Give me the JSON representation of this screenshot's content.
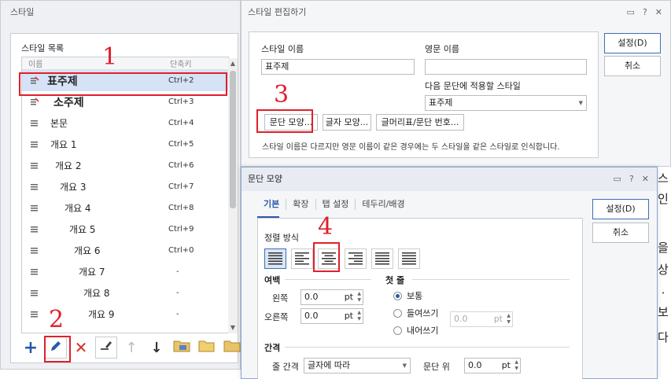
{
  "style_dialog": {
    "title": "스타일",
    "group_title": "스타일 목록",
    "col_name": "이름",
    "col_shortcut": "단축키",
    "items": [
      {
        "name": "표주제",
        "shortcut": "Ctrl+2"
      },
      {
        "name": "소주제",
        "shortcut": "Ctrl+3"
      },
      {
        "name": "본문",
        "shortcut": "Ctrl+4"
      },
      {
        "name": "개요 1",
        "shortcut": "Ctrl+5"
      },
      {
        "name": "개요 2",
        "shortcut": "Ctrl+6"
      },
      {
        "name": "개요 3",
        "shortcut": "Ctrl+7"
      },
      {
        "name": "개요 4",
        "shortcut": "Ctrl+8"
      },
      {
        "name": "개요 5",
        "shortcut": "Ctrl+9"
      },
      {
        "name": "개요 6",
        "shortcut": "Ctrl+0"
      },
      {
        "name": "개요 7",
        "shortcut": "-"
      },
      {
        "name": "개요 8",
        "shortcut": "-"
      },
      {
        "name": "개요 9",
        "shortcut": "-"
      }
    ]
  },
  "edit_dialog": {
    "title": "스타일 편집하기",
    "style_name_label": "스타일 이름",
    "style_name_value": "표주제",
    "english_name_label": "영문 이름",
    "english_name_value": "",
    "next_style_label": "다음 문단에 적용할 스타일",
    "next_style_value": "표주제",
    "para_shape_btn": "문단 모양...",
    "char_shape_btn": "글자 모양...",
    "bullet_btn": "글머리표/문단 번호...",
    "note": "스타일 이름은 다르지만 영문 이름이 같은 경우에는 두 스타일을 같은 스타일로 인식합니다.",
    "ok": "설정(D)",
    "cancel": "취소"
  },
  "para_dialog": {
    "title": "문단 모양",
    "tabs": [
      "기본",
      "확장",
      "탭 설정",
      "테두리/배경"
    ],
    "align_label": "정렬 방식",
    "margin_title": "여백",
    "left_label": "왼쪽",
    "left_value": "0.0",
    "right_label": "오른쪽",
    "right_value": "0.0",
    "unit": "pt",
    "first_line_title": "첫 줄",
    "opt_normal": "보통",
    "opt_indent": "들여쓰기",
    "opt_outdent": "내어쓰기",
    "indent_value": "0.0",
    "spacing_title": "간격",
    "line_spacing_label": "줄 간격",
    "line_spacing_value": "글자에 따라",
    "para_before_label": "문단 위",
    "para_before_value": "0.0",
    "ok": "설정(D)",
    "cancel": "취소"
  },
  "annotations": [
    "1",
    "2",
    "3",
    "4"
  ],
  "bg_text": [
    "스",
    "인",
    "을",
    "상",
    "ㆍ",
    "보",
    "다"
  ],
  "colors": {
    "accent": "#2a5aa8",
    "annotation": "#e0202a",
    "selected_row": "#d6e2f5"
  }
}
